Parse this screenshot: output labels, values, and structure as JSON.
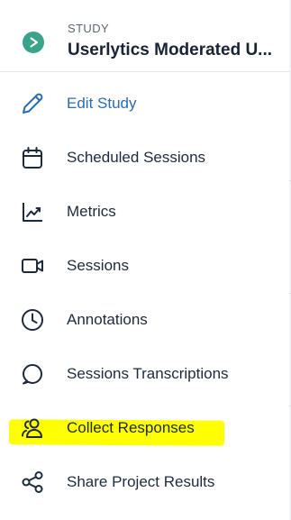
{
  "colors": {
    "accent": "#2d6cb0",
    "study_badge": "#3aa389",
    "text": "#1e2a3b",
    "highlight": "#ffff00"
  },
  "study": {
    "kicker": "STUDY",
    "title": "Userlytics Moderated U..."
  },
  "nav": {
    "items": [
      {
        "label": "Edit Study",
        "icon": "pencil-icon",
        "active": true
      },
      {
        "label": "Scheduled Sessions",
        "icon": "calendar-icon",
        "active": false
      },
      {
        "label": "Metrics",
        "icon": "line-chart-icon",
        "active": false
      },
      {
        "label": "Sessions",
        "icon": "video-camera-icon",
        "active": false
      },
      {
        "label": "Annotations",
        "icon": "clock-icon",
        "active": false
      },
      {
        "label": "Sessions Transcriptions",
        "icon": "speech-bubble-icon",
        "active": false
      },
      {
        "label": "Collect Responses",
        "icon": "users-icon",
        "active": false,
        "highlighted": true
      },
      {
        "label": "Share Project Results",
        "icon": "share-icon",
        "active": false
      }
    ]
  }
}
